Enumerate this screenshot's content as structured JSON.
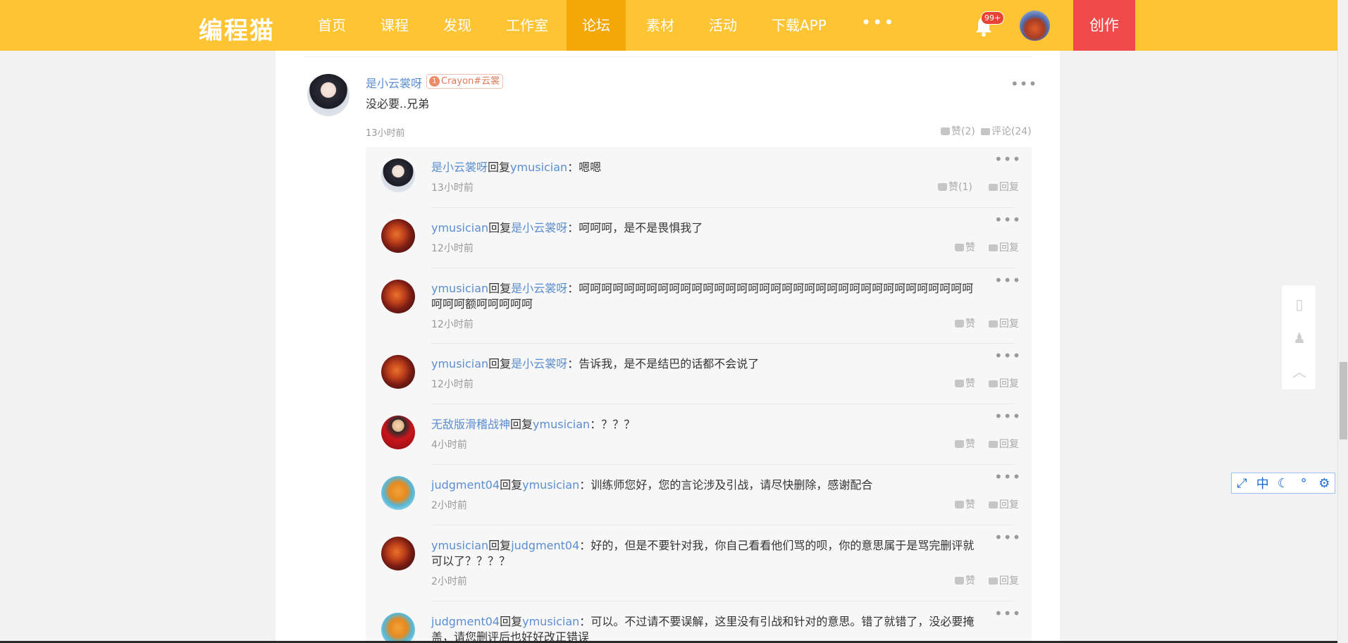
{
  "nav": {
    "logo": "编程猫",
    "items": [
      "首页",
      "课程",
      "发现",
      "工作室",
      "论坛",
      "素材",
      "活动",
      "下载APP"
    ],
    "active_index": 4,
    "more": "•••",
    "badge": "99+",
    "create": "创作"
  },
  "main": {
    "author": "是小云裳呀",
    "tag_level": "1",
    "tag": "Crayon#云裳",
    "text": "没必要..兄弟",
    "time": "13小时前",
    "like": "赞(2)",
    "comment": "评论(24)"
  },
  "replies": [
    {
      "user": "是小云裳呀",
      "reply_word": "回复",
      "to": "ymusician",
      "sep": "：",
      "text": "嗯嗯",
      "time": "13小时前",
      "like": "赞(1)",
      "reply": "回复",
      "avatar": "girl"
    },
    {
      "user": "ymusician",
      "reply_word": "回复",
      "to": "是小云裳呀",
      "sep": "：",
      "text": "呵呵呵，是不是畏惧我了",
      "time": "12小时前",
      "like": "赞",
      "reply": "回复",
      "avatar": "fire"
    },
    {
      "user": "ymusician",
      "reply_word": "回复",
      "to": "是小云裳呀",
      "sep": "：",
      "text": "呵呵呵呵呵呵呵呵呵呵呵呵呵呵呵呵呵呵呵呵呵呵呵呵呵呵呵呵呵呵呵呵呵呵呵呵呵呵额呵呵呵呵呵",
      "time": "12小时前",
      "like": "赞",
      "reply": "回复",
      "avatar": "fire"
    },
    {
      "user": "ymusician",
      "reply_word": "回复",
      "to": "是小云裳呀",
      "sep": "：",
      "text": "告诉我，是不是结巴的话都不会说了",
      "time": "12小时前",
      "like": "赞",
      "reply": "回复",
      "avatar": "fire"
    },
    {
      "user": "无敌版滑稽战神",
      "reply_word": "回复",
      "to": "ymusician",
      "sep": "：",
      "text": "？？？",
      "time": "4小时前",
      "like": "赞",
      "reply": "回复",
      "avatar": "red"
    },
    {
      "user": "judgment04",
      "reply_word": "回复",
      "to": "ymusician",
      "sep": "：",
      "text": "训练师您好，您的言论涉及引战，请尽快删除，感谢配合",
      "time": "2小时前",
      "like": "赞",
      "reply": "回复",
      "avatar": "fish"
    },
    {
      "user": "ymusician",
      "reply_word": "回复",
      "to": "judgment04",
      "sep": "：",
      "text": "好的，但是不要针对我，你自己看看他们骂的呗，你的意思属于是骂完删评就可以了？？？？",
      "time": "2小时前",
      "like": "赞",
      "reply": "回复",
      "avatar": "fire"
    },
    {
      "user": "judgment04",
      "reply_word": "回复",
      "to": "ymusician",
      "sep": "：",
      "text": "可以。不过请不要误解，这里没有引战和针对的意思。错了就错了，没必要掩盖，请您删评后也好好改正错误",
      "time": "",
      "like": "",
      "reply": "",
      "avatar": "fish"
    }
  ],
  "float_bar": [
    "⤢",
    "中",
    "☾",
    "°",
    "⚙"
  ],
  "side_tools": [
    "mobile-icon",
    "qq-icon",
    "back-to-top-icon"
  ]
}
